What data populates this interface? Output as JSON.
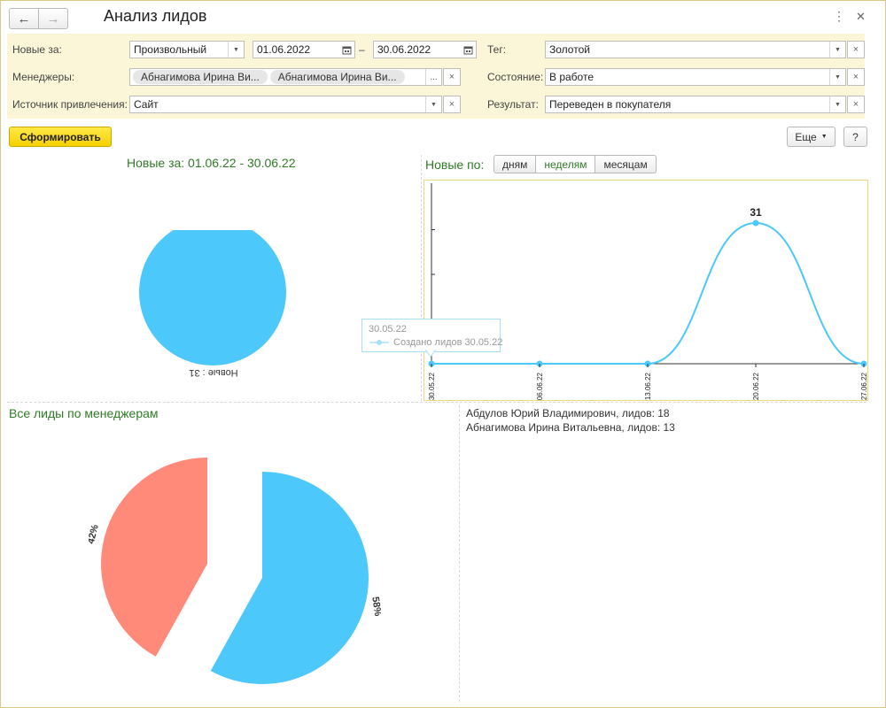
{
  "window": {
    "title": "Анализ лидов",
    "more_icon": "more-vertical-icon",
    "close_icon": "close-icon"
  },
  "filters": {
    "period_label": "Новые за:",
    "period_type": "Произвольный",
    "date_from": "01.06.2022",
    "date_to": "30.06.2022",
    "date_dash": "–",
    "managers_label": "Менеджеры:",
    "managers": [
      "Абнагимова Ирина Ви...",
      "Абнагимова Ирина Ви..."
    ],
    "source_label": "Источник привлечения:",
    "source": "Сайт",
    "tag_label": "Тег:",
    "tag": "Золотой",
    "state_label": "Состояние:",
    "state": "В работе",
    "result_label": "Результат:",
    "result": "Переведен в покупателя",
    "ellipsis": "...",
    "clear": "×"
  },
  "toolbar": {
    "generate": "Сформировать",
    "more": "Еще",
    "help": "?"
  },
  "pie_new": {
    "title": "Новые за: 01.06.22 - 30.06.22",
    "slice_label": "Новые : 31"
  },
  "line": {
    "title": "Новые по:",
    "tabs": [
      "дням",
      "неделям",
      "месяцам"
    ],
    "active_tab": 1,
    "tooltip_date": "30.05.22",
    "tooltip_text": "Создано лидов 30.05.22"
  },
  "managers_pie": {
    "title": "Все лиды по менеджерам",
    "legend": [
      "Абдулов Юрий Владимирович, лидов: 18",
      "Абнагимова Ирина Витальевна, лидов: 13"
    ]
  },
  "colors": {
    "blue": "#4dc8fb",
    "salmon": "#ff8a7a",
    "green": "#2f7b26",
    "accent_yellow": "#ffe94a"
  },
  "chart_data": [
    {
      "type": "line",
      "x": [
        "30.05.22",
        "06.06.22",
        "13.06.22",
        "20.06.22",
        "27.06.22"
      ],
      "series": [
        {
          "values": [
            0,
            0,
            0,
            31,
            0
          ]
        }
      ],
      "data_labels": [
        "",
        "",
        "",
        "31",
        ""
      ],
      "ylim": [
        0,
        31
      ]
    },
    {
      "type": "pie",
      "categories": [
        "Новые"
      ],
      "values": [
        31
      ],
      "labels": [
        "Новые : 31"
      ]
    },
    {
      "type": "pie",
      "categories": [
        "Абдулов Юрий Владимирович",
        "Абнагимова Ирина Витальевна"
      ],
      "values": [
        18,
        13
      ],
      "labels": [
        "58%",
        "42%"
      ]
    }
  ]
}
